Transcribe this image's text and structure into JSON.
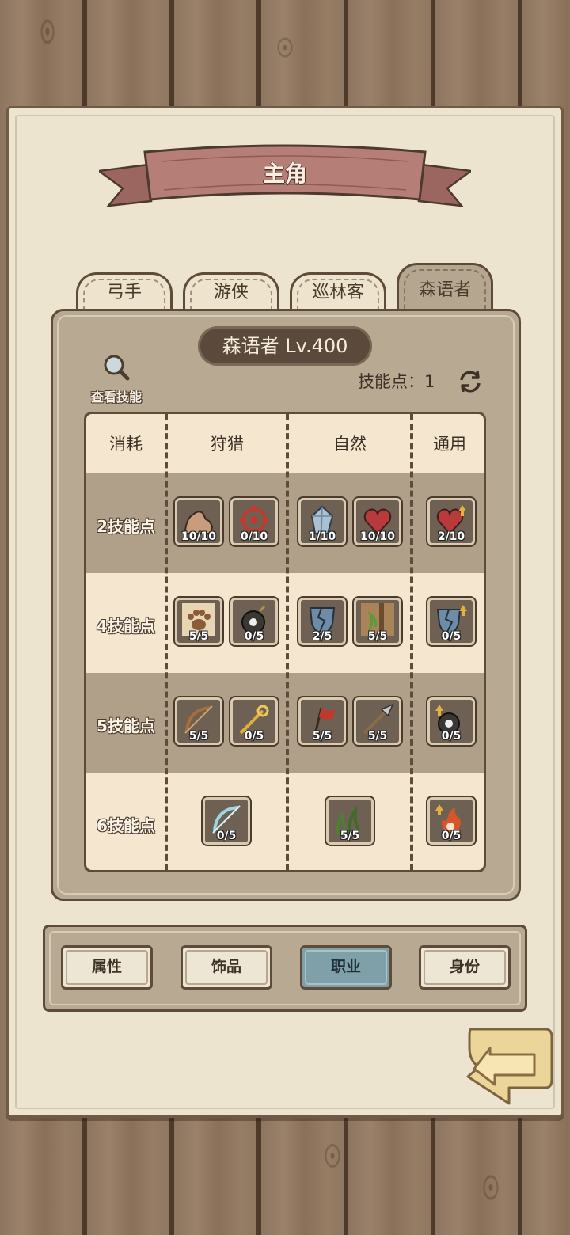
{
  "title": "主角",
  "tabs": [
    {
      "label": "弓手",
      "active": false
    },
    {
      "label": "游侠",
      "active": false
    },
    {
      "label": "巡林客",
      "active": false
    },
    {
      "label": "森语者",
      "active": true
    }
  ],
  "class_level": "森语者 Lv.400",
  "view_skills_label": "查看技能",
  "skill_points_label": "技能点：",
  "skill_points_value": "1",
  "table": {
    "headers": [
      "消耗",
      "狩猎",
      "自然",
      "通用"
    ],
    "rows": [
      {
        "cost": "2技能点",
        "hunting": [
          "10/10",
          "0/10"
        ],
        "nature": [
          "1/10",
          "10/10"
        ],
        "general": [
          "2/10"
        ]
      },
      {
        "cost": "4技能点",
        "hunting": [
          "5/5",
          "0/5"
        ],
        "nature": [
          "2/5",
          "5/5"
        ],
        "general": [
          "0/5"
        ]
      },
      {
        "cost": "5技能点",
        "hunting": [
          "5/5",
          "0/5"
        ],
        "nature": [
          "5/5",
          "5/5"
        ],
        "general": [
          "0/5"
        ]
      },
      {
        "cost": "6技能点",
        "hunting": [
          "0/5"
        ],
        "nature": [
          "5/5"
        ],
        "general": [
          "0/5"
        ]
      }
    ]
  },
  "bottom_nav": [
    {
      "label": "属性",
      "active": false
    },
    {
      "label": "饰品",
      "active": false
    },
    {
      "label": "职业",
      "active": true
    },
    {
      "label": "身份",
      "active": false
    }
  ],
  "colors": {
    "ribbon": "#b57f78",
    "active_nav": "#7fa0a8",
    "panel": "#b8aa92",
    "paper": "#ede4cf"
  }
}
